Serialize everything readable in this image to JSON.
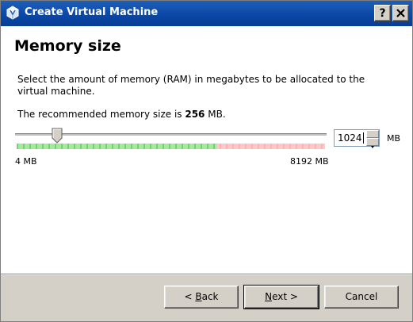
{
  "window": {
    "title": "Create Virtual Machine",
    "help_button": "?",
    "close_button": "X"
  },
  "page": {
    "title": "Memory size",
    "description": "Select the amount of memory (RAM) in megabytes to be allocated to the virtual machine.",
    "recommend_prefix": "The recommended memory size is ",
    "recommend_value": "256",
    "recommend_suffix": " MB."
  },
  "memory_slider": {
    "min_label": "4 MB",
    "max_label": "8192 MB",
    "min_mb": 4,
    "max_mb": 8192,
    "value_mb": 1024,
    "safe_color": "#33cc33",
    "unsafe_color": "#ff9999"
  },
  "memory_input": {
    "value": "1024",
    "unit": "MB"
  },
  "buttons": {
    "back_prefix": "< ",
    "back_mnemonic": "B",
    "back_rest": "ack",
    "next_mnemonic": "N",
    "next_rest": "ext >",
    "cancel": "Cancel"
  }
}
